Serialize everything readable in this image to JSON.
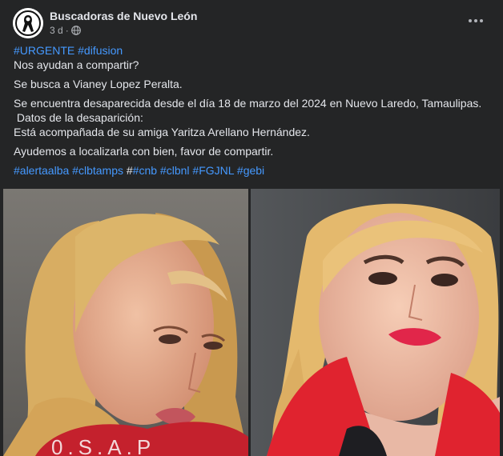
{
  "post": {
    "page_name": "Buscadoras de Nuevo León",
    "timestamp": "3 d",
    "separator": "·",
    "audience_icon": "globe-icon",
    "more_icon": "more-options-icon",
    "body": {
      "tags_top": [
        "#URGENTE",
        "#difusion"
      ],
      "line1": "Nos ayudan a compartir?",
      "line2": "Se busca a Vianey Lopez Peralta.",
      "line3": "Se encuentra desaparecida desde el día 18 de marzo del 2024 en Nuevo Laredo, Tamaulipas.",
      "line4": " Datos de la desaparición:",
      "line5": "Está acompañada de su amiga Yaritza Arellano Hernández.",
      "line6": "Ayudemos a localizarla con bien, favor de compartir.",
      "tags_bottom": [
        "#alertaalba",
        "#clbtamps",
        "#",
        "#cnb",
        "#clbnl",
        "#FGJNL",
        "#gebi"
      ]
    },
    "photos": [
      {
        "name": "photo-left",
        "shirt_color": "#c4212d",
        "shirt_text": "0.S.A.P"
      },
      {
        "name": "photo-right",
        "jacket_color": "#e0232f"
      }
    ]
  }
}
